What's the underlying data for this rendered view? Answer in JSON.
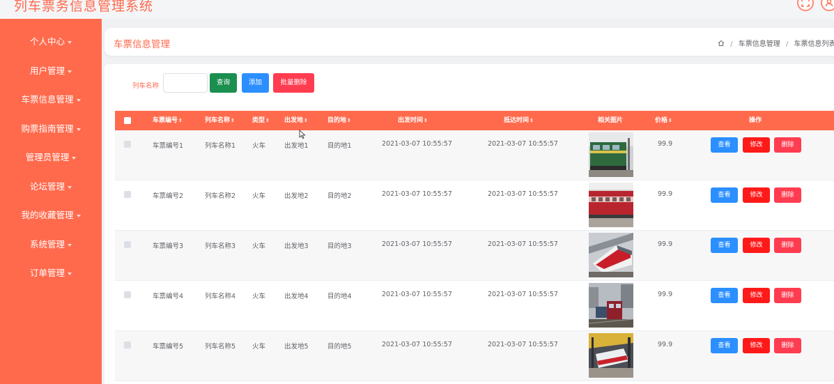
{
  "app": {
    "title": "列车票务信息管理系统"
  },
  "sidebar": {
    "items": [
      {
        "label": "个人中心"
      },
      {
        "label": "用户管理"
      },
      {
        "label": "车票信息管理"
      },
      {
        "label": "购票指南管理"
      },
      {
        "label": "管理员管理"
      },
      {
        "label": "论坛管理"
      },
      {
        "label": "我的收藏管理"
      },
      {
        "label": "系统管理"
      },
      {
        "label": "订单管理"
      }
    ]
  },
  "header": {
    "title": "车票信息管理",
    "breadcrumb": [
      "车票信息管理",
      "车票信息列表"
    ]
  },
  "search": {
    "label": "列车名称",
    "value": "",
    "query_label": "查询",
    "add_label": "添加",
    "batch_delete_label": "批量删除"
  },
  "table": {
    "columns": [
      "车票编号",
      "列车名称",
      "类型",
      "出发地",
      "目的地",
      "出发时间",
      "抵达时间",
      "相关图片",
      "价格",
      "操作"
    ],
    "action_labels": {
      "view": "查看",
      "edit": "修改",
      "delete": "删除"
    },
    "rows": [
      {
        "ticket_no": "车票编号1",
        "train_name": "列车名称1",
        "type": "火车",
        "origin": "出发地1",
        "destination": "目的地1",
        "depart": "2021-03-07 10:55:57",
        "arrive": "2021-03-07 10:55:57",
        "price": "99.9"
      },
      {
        "ticket_no": "车票编号2",
        "train_name": "列车名称2",
        "type": "火车",
        "origin": "出发地2",
        "destination": "目的地2",
        "depart": "2021-03-07 10:55:57",
        "arrive": "2021-03-07 10:55:57",
        "price": "99.9"
      },
      {
        "ticket_no": "车票编号3",
        "train_name": "列车名称3",
        "type": "火车",
        "origin": "出发地3",
        "destination": "目的地3",
        "depart": "2021-03-07 10:55:57",
        "arrive": "2021-03-07 10:55:57",
        "price": "99.9"
      },
      {
        "ticket_no": "车票编号4",
        "train_name": "列车名称4",
        "type": "火车",
        "origin": "出发地4",
        "destination": "目的地4",
        "depart": "2021-03-07 10:55:57",
        "arrive": "2021-03-07 10:55:57",
        "price": "99.9"
      },
      {
        "ticket_no": "车票编号5",
        "train_name": "列车名称5",
        "type": "火车",
        "origin": "出发地5",
        "destination": "目的地5",
        "depart": "2021-03-07 10:55:57",
        "arrive": "2021-03-07 10:55:57",
        "price": "99.9"
      }
    ]
  },
  "icons": {
    "fullscreen": "fullscreen-icon",
    "user": "user-icon",
    "home": "home-icon",
    "sort": "sort-icon",
    "caret": "caret-down-icon"
  },
  "colors": {
    "brand": "#ff6a4d",
    "query": "#1a8f4f",
    "primary": "#2b8fff",
    "danger": "#ff3c50",
    "edit": "#ff1a1a"
  }
}
